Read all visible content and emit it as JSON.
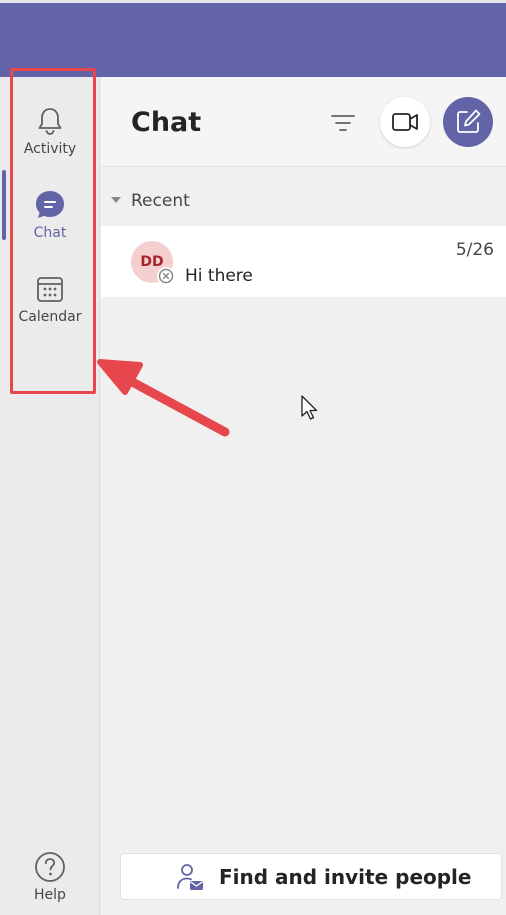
{
  "app_bar": {
    "items": [
      {
        "label": "Activity",
        "icon": "bell-icon"
      },
      {
        "label": "Chat",
        "icon": "chat-bubble-icon",
        "active": true
      },
      {
        "label": "Calendar",
        "icon": "calendar-icon"
      }
    ],
    "help_label": "Help"
  },
  "chat_panel": {
    "title": "Chat",
    "recent_label": "Recent",
    "conversations": [
      {
        "initials": "DD",
        "preview": "Hi there",
        "time": "5/26"
      }
    ],
    "find_people_label": "Find and invite people"
  },
  "colors": {
    "brand": "#6264a7",
    "highlight": "#e8464d",
    "avatar_bg": "#f5cfcf",
    "avatar_text": "#a4262c"
  }
}
